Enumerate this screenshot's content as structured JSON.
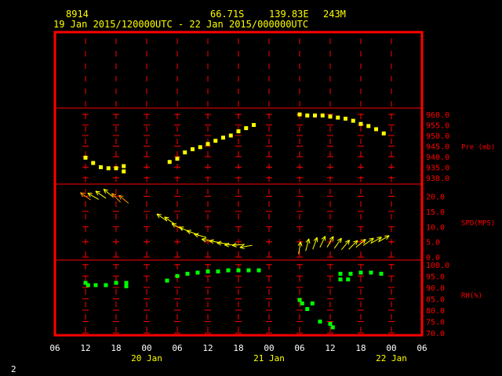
{
  "header": {
    "station": "8914",
    "lat": "66.71S",
    "lon": "139.83E",
    "elev": "243M",
    "time_range": "19 Jan 2015/120000UTC - 22 Jan 2015/000000UTC"
  },
  "page_number": "2",
  "colors": {
    "frame": "#ff0000",
    "grid": "#ff0000",
    "header": "#ffff00",
    "pressure": "#ffff00",
    "wind": "#ffff00",
    "rh": "#00ff00",
    "tick_labels": "#ff0000",
    "time_labels": "#ffff00"
  },
  "chart_data": {
    "type": "scatter",
    "x_tick_labels": [
      "06",
      "12",
      "18",
      "00",
      "06",
      "12",
      "18",
      "00",
      "06",
      "12",
      "18",
      "00",
      "06"
    ],
    "date_labels": [
      {
        "label": "20 Jan",
        "at_hour": 24
      },
      {
        "label": "21 Jan",
        "at_hour": 48
      },
      {
        "label": "22 Jan",
        "at_hour": 72
      }
    ],
    "x_unit": "hours since 19 Jan 2015 00UTC",
    "xlim": [
      6,
      78
    ],
    "panels": [
      {
        "id": "pressure",
        "label": "Pre (mb)",
        "ylim": [
          927,
          963
        ],
        "y_ticks": [
          "930.0",
          "935.0",
          "940.0",
          "945.0",
          "950.0",
          "955.0",
          "960.0"
        ],
        "series": [
          {
            "marker": "square",
            "points": [
              [
                12,
                939.5
              ],
              [
                13.5,
                937
              ],
              [
                15,
                935
              ],
              [
                16.5,
                934.5
              ],
              [
                18,
                934.5
              ],
              [
                19.5,
                935.5
              ],
              [
                19.5,
                933
              ],
              [
                28.5,
                937.5
              ],
              [
                30,
                939
              ],
              [
                31.5,
                942
              ],
              [
                33,
                943.5
              ],
              [
                34.5,
                944.5
              ],
              [
                36,
                946
              ],
              [
                37.5,
                947.5
              ],
              [
                39,
                949
              ],
              [
                40.5,
                950
              ],
              [
                42,
                952
              ],
              [
                43.5,
                953.5
              ],
              [
                45,
                955
              ],
              [
                54,
                960
              ],
              [
                55.5,
                959.5
              ],
              [
                57,
                959.5
              ],
              [
                58.5,
                959.5
              ],
              [
                60,
                959
              ],
              [
                61.5,
                958.5
              ],
              [
                63,
                958
              ],
              [
                64.5,
                957
              ],
              [
                66,
                955.5
              ],
              [
                67.5,
                954.5
              ],
              [
                69,
                953
              ],
              [
                70.5,
                951
              ]
            ]
          }
        ]
      },
      {
        "id": "wind",
        "label": "SPD(MPS)",
        "ylim": [
          -1,
          24
        ],
        "y_ticks": [
          "0.0",
          "5.0",
          "10.0",
          "15.0",
          "20.0"
        ],
        "series": [
          {
            "marker": "arrow",
            "points": [
              [
                12,
                20,
                145,
                "#ff9900"
              ],
              [
                13.5,
                20,
                150,
                "#ffff00"
              ],
              [
                15,
                20.5,
                145,
                "#ffff00"
              ],
              [
                16.5,
                21,
                140,
                "#ffff00"
              ],
              [
                18,
                19.5,
                135,
                "#ff9900"
              ],
              [
                19.5,
                19,
                140,
                "#ff9900"
              ],
              [
                27,
                13,
                145,
                "#ffff00"
              ],
              [
                28.5,
                12,
                145,
                "#ffff00"
              ],
              [
                30,
                10,
                150,
                "#ffff00"
              ],
              [
                31.5,
                9,
                155,
                "#ffff00"
              ],
              [
                33,
                8,
                160,
                "#ffff00"
              ],
              [
                34.5,
                7,
                165,
                "#ffff00"
              ],
              [
                36,
                5.5,
                170,
                "#ffff00"
              ],
              [
                37.5,
                5,
                170,
                "#ffff00"
              ],
              [
                39,
                4.5,
                175,
                "#ffff00"
              ],
              [
                40.5,
                4,
                180,
                "#ffff00"
              ],
              [
                42,
                4,
                185,
                "#ffff00"
              ],
              [
                43.5,
                3.5,
                190,
                "#ffff00"
              ],
              [
                54,
                3,
                80,
                "#ffff00"
              ],
              [
                55.5,
                4,
                75,
                "#ffff00"
              ],
              [
                57,
                4.5,
                70,
                "#ffff00"
              ],
              [
                58.5,
                5,
                65,
                "#ffff00"
              ],
              [
                60,
                5,
                60,
                "#ffff00"
              ],
              [
                61.5,
                4.5,
                55,
                "#ffff00"
              ],
              [
                63,
                4,
                50,
                "#ffff00"
              ],
              [
                64.5,
                4,
                45,
                "#ffff00"
              ],
              [
                66,
                4.5,
                40,
                "#ffff00"
              ],
              [
                67.5,
                5,
                35,
                "#ffff00"
              ],
              [
                69,
                5.5,
                30,
                "#ffff00"
              ],
              [
                70.5,
                6,
                30,
                "#ffff00"
              ]
            ]
          }
        ]
      },
      {
        "id": "rh",
        "label": "RH(%)",
        "ylim": [
          69,
          102
        ],
        "y_ticks": [
          "70.0",
          "75.0",
          "80.0",
          "85.0",
          "90.0",
          "95.0",
          "100.0"
        ],
        "series": [
          {
            "marker": "square",
            "points": [
              [
                12,
                92
              ],
              [
                12.5,
                91
              ],
              [
                14,
                91
              ],
              [
                16,
                91
              ],
              [
                18,
                92
              ],
              [
                20,
                92
              ],
              [
                20,
                90.5
              ],
              [
                28,
                93
              ],
              [
                30,
                95
              ],
              [
                32,
                96
              ],
              [
                34,
                96.5
              ],
              [
                36,
                97
              ],
              [
                38,
                97
              ],
              [
                40,
                97.5
              ],
              [
                42,
                97.5
              ],
              [
                44,
                97.5
              ],
              [
                46,
                97.5
              ],
              [
                54,
                84.5
              ],
              [
                54.5,
                83
              ],
              [
                55.5,
                80.5
              ],
              [
                56.5,
                83
              ],
              [
                58,
                75
              ],
              [
                60,
                74
              ],
              [
                60.5,
                72.5
              ],
              [
                62,
                93.5
              ],
              [
                62,
                96
              ],
              [
                63.5,
                93.5
              ],
              [
                64,
                96
              ],
              [
                66,
                96.5
              ],
              [
                68,
                96.5
              ],
              [
                70,
                96
              ]
            ]
          }
        ]
      }
    ]
  }
}
